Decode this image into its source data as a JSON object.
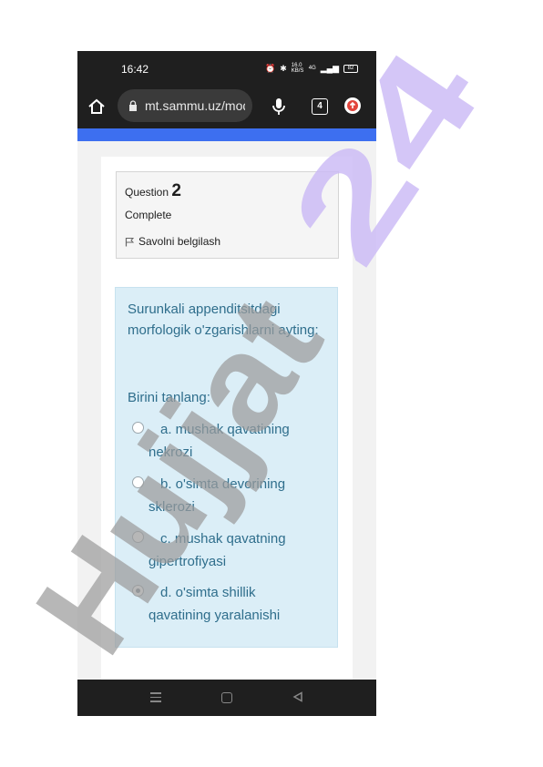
{
  "status_bar": {
    "time": "16:42",
    "network_speed": "16.0 KB/S",
    "signal_label": "4G",
    "battery": "82"
  },
  "browser": {
    "url": "mt.sammu.uz/mod/quiz",
    "tab_count": "4",
    "accent_color": "#3d6ff0"
  },
  "question": {
    "label": "Question",
    "number": "2",
    "state": "Complete",
    "flag_label": "Savolni belgilash",
    "text": "Surunkali appenditsitdagi morfologik o'zgarishlarni ayting:",
    "prompt": "Birini tanlang:",
    "answers": [
      {
        "label": "a. mushak qavatining nekrozi",
        "checked": false
      },
      {
        "label": "b. o'simta devorining sklerozi",
        "checked": false
      },
      {
        "label": "c. mushak qavatning gipertrofiyasi",
        "checked": false
      },
      {
        "label": "d. o'simta shillik qavatining yaralanishi",
        "checked": true
      }
    ]
  },
  "watermark": {
    "text": "Hujjat24",
    "color_gray": "#9b9b9b",
    "color_purple": "#c9b8f5"
  }
}
